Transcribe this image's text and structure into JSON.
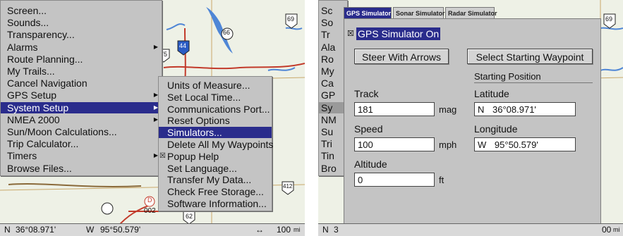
{
  "left": {
    "main_menu": [
      {
        "label": "Screen..."
      },
      {
        "label": "Sounds..."
      },
      {
        "label": "Transparency..."
      },
      {
        "label": "Alarms",
        "submenu": true
      },
      {
        "label": "Route Planning..."
      },
      {
        "label": "My Trails..."
      },
      {
        "label": "Cancel Navigation"
      },
      {
        "label": "GPS Setup",
        "submenu": true
      },
      {
        "label": "System Setup",
        "submenu": true,
        "selected": true
      },
      {
        "label": "NMEA 2000",
        "submenu": true
      },
      {
        "label": "Sun/Moon Calculations..."
      },
      {
        "label": "Trip Calculator..."
      },
      {
        "label": "Timers",
        "submenu": true
      },
      {
        "label": "Browse Files..."
      }
    ],
    "submenu": [
      {
        "label": "Units of Measure..."
      },
      {
        "label": "Set Local Time..."
      },
      {
        "label": "Communications Port..."
      },
      {
        "label": "Reset Options"
      },
      {
        "label": "Simulators...",
        "selected": true
      },
      {
        "label": "Delete All My Waypoints"
      },
      {
        "label": "Popup Help",
        "checked": true
      },
      {
        "label": "Set Language..."
      },
      {
        "label": "Transfer My Data..."
      },
      {
        "label": "Check Free Storage..."
      },
      {
        "label": "Software Information..."
      }
    ],
    "status": {
      "lat_hemi": "N",
      "lat": "36°08.971'",
      "lon_hemi": "W",
      "lon": "95°50.579'",
      "arrow": "↔",
      "zoom": "100",
      "zoom_unit": "mi"
    },
    "map_labels": {
      "road_66": "66",
      "road_44": "44",
      "road_69": "69",
      "road_75": "75",
      "road_412": "412",
      "road_d": "D",
      "label_002": "002",
      "road_62": "62"
    }
  },
  "right": {
    "bg_menu_fragments": [
      "Sc",
      "So",
      "Tr",
      "Ala",
      "Ro",
      "My",
      "Ca",
      "GP",
      "Sy",
      "NM",
      "Su",
      "Tri",
      "Tin",
      "Bro"
    ],
    "tabs": [
      "GPS Simulator",
      "Sonar Simulator",
      "Radar Simulator"
    ],
    "gps_on_label": "GPS Simulator On",
    "gps_on_checked": true,
    "steer_button": "Steer With Arrows",
    "select_button": "Select Starting Waypoint",
    "starting_position": "Starting Position",
    "track_label": "Track",
    "track_value": "181",
    "track_unit": "mag",
    "speed_label": "Speed",
    "speed_value": "100",
    "speed_unit": "mph",
    "altitude_label": "Altitude",
    "altitude_value": "0",
    "altitude_unit": "ft",
    "latitude_label": "Latitude",
    "latitude_hemi": "N",
    "latitude_value": "36°08.971'",
    "longitude_label": "Longitude",
    "longitude_hemi": "W",
    "longitude_value": "95°50.579'",
    "status_lat_hemi": "N",
    "status_lat_frag": "3",
    "status_zoom_frag": "00",
    "status_zoom_unit": "mi",
    "map_road_69": "69"
  },
  "colors": {
    "menu_bg": "#c4c4c4",
    "selection": "#2a2c8c",
    "map_bg": "#eef1e6",
    "water": "#4f86d6",
    "road": "#c23a2a"
  }
}
